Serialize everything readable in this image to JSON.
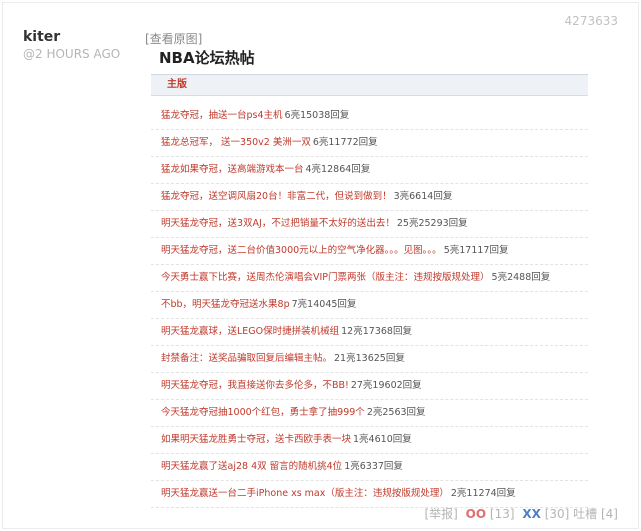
{
  "post": {
    "id": "4273633",
    "author": "kiter",
    "time": "@2 HOURS AGO",
    "view_original": "[查看原图]"
  },
  "forum": {
    "title": "NBA论坛热帖",
    "section": "主版"
  },
  "threads": [
    {
      "title": "猛龙夺冠，抽送一台ps4主机",
      "stats": "6亮15038回复"
    },
    {
      "title": "猛龙总冠军， 送一350v2 美洲一双",
      "stats": "6亮11772回复"
    },
    {
      "title": "猛龙如果夺冠，送高端游戏本一台",
      "stats": "4亮12864回复"
    },
    {
      "title": "猛龙夺冠，送空调风扇20台！非富二代，但说到做到！",
      "stats": "3亮6614回复"
    },
    {
      "title": "明天猛龙夺冠，送3双AJ，不过把销量不太好的送出去！",
      "stats": "25亮25293回复"
    },
    {
      "title": "明天猛龙夺冠，送二台价值3000元以上的空气净化器。。。见图。。。",
      "stats": "5亮17117回复"
    },
    {
      "title": "今天勇士赢下比赛，送周杰伦演唱会VIP门票两张（版主注：违规按版规处理）",
      "stats": "5亮2488回复"
    },
    {
      "title": "不bb，明天猛龙夺冠送水果8p",
      "stats": "7亮14045回复"
    },
    {
      "title": "明天猛龙赢球，送LEGO保时捷拼装机械组",
      "stats": "12亮17368回复"
    },
    {
      "title": "封禁备注：送奖品骗取回复后编辑主帖。",
      "stats": "21亮13625回复"
    },
    {
      "title": "明天猛龙夺冠，我直接送你去多伦多，不BB!",
      "stats": "27亮19602回复"
    },
    {
      "title": "今天猛龙夺冠抽1000个红包，勇士拿了抽999个",
      "stats": "2亮2563回复"
    },
    {
      "title": "如果明天猛龙胜勇士夺冠，送卡西欧手表一块",
      "stats": "1亮4610回复"
    },
    {
      "title": "明天猛龙赢了送aj28 4双 留言的随机挑4位",
      "stats": "1亮6337回复"
    },
    {
      "title": "明天猛龙赢送一台二手iPhone xs max（版主注：违规按版规处理）",
      "stats": "2亮11274回复"
    }
  ],
  "footer": {
    "report": "[举报]",
    "oo_label": "OO",
    "oo_count": "[13]",
    "xx_label": "XX",
    "xx_count": "[30]",
    "comments": "吐槽 [4]"
  }
}
